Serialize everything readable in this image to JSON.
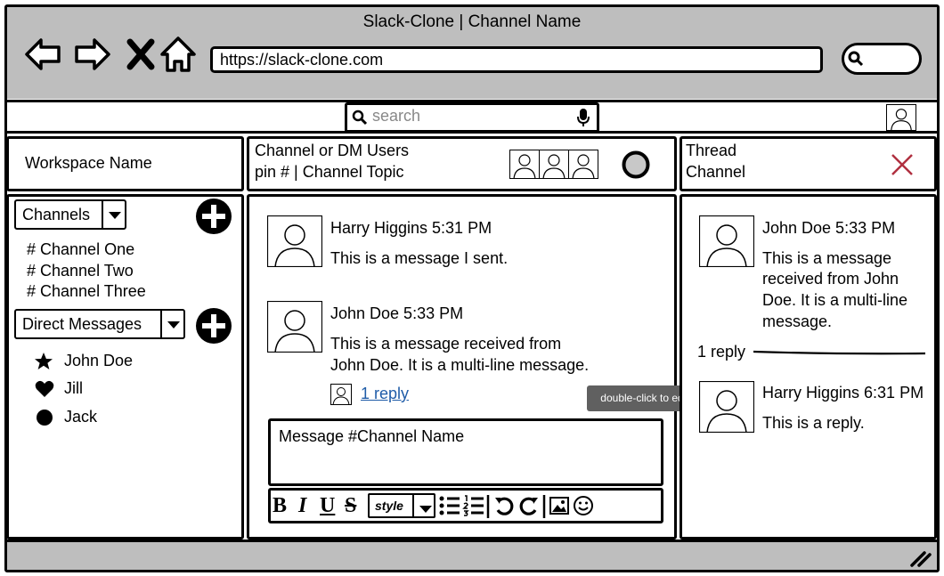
{
  "window": {
    "title": "Slack-Clone | Channel Name",
    "url": "https://slack-clone.com"
  },
  "icons": {
    "back": "back-arrow-icon",
    "forward": "forward-arrow-icon",
    "close": "close-icon",
    "home": "home-icon",
    "search": "search-icon",
    "mic": "microphone-icon",
    "user": "user-avatar-icon",
    "add": "plus-circle-icon",
    "star": "star-icon",
    "heart": "heart-icon",
    "circle": "circle-icon"
  },
  "toolbar": {
    "search_placeholder": "search"
  },
  "workspace": {
    "name": "Workspace Name"
  },
  "channel_header": {
    "line1": "Channel or DM Users",
    "line2": "pin # | Channel Topic"
  },
  "thread_header": {
    "line1": "Thread",
    "line2": "Channel"
  },
  "sidebar": {
    "channels_label": "Channels",
    "channels": [
      "# Channel One",
      "# Channel Two",
      "# Channel Three"
    ],
    "dm_label": "Direct Messages",
    "dms": [
      {
        "name": "John Doe",
        "icon": "star-icon"
      },
      {
        "name": "Jill",
        "icon": "heart-icon"
      },
      {
        "name": "Jack",
        "icon": "circle-icon"
      }
    ]
  },
  "messages": [
    {
      "header": "Harry Higgins 5:31 PM",
      "text": "This is a message I sent."
    },
    {
      "header": "John Doe 5:33 PM",
      "text_line1": "This is a message received from",
      "text_line2": "John Doe. It is a multi-line message.",
      "reply_link": "1 reply"
    }
  ],
  "tooltip": "double-click to edit",
  "compose": {
    "placeholder": "Message #Channel Name",
    "format": {
      "bold": "B",
      "italic": "I",
      "underline": "U",
      "strike": "S",
      "style": "style"
    }
  },
  "thread": {
    "parent": {
      "header": "John Doe 5:33 PM",
      "lines": [
        "This is a message",
        "received from John",
        "Doe. It is a multi-line",
        "message."
      ]
    },
    "reply_count": "1 reply",
    "reply": {
      "header": "Harry Higgins 6:31 PM",
      "text": "This is a reply."
    }
  }
}
